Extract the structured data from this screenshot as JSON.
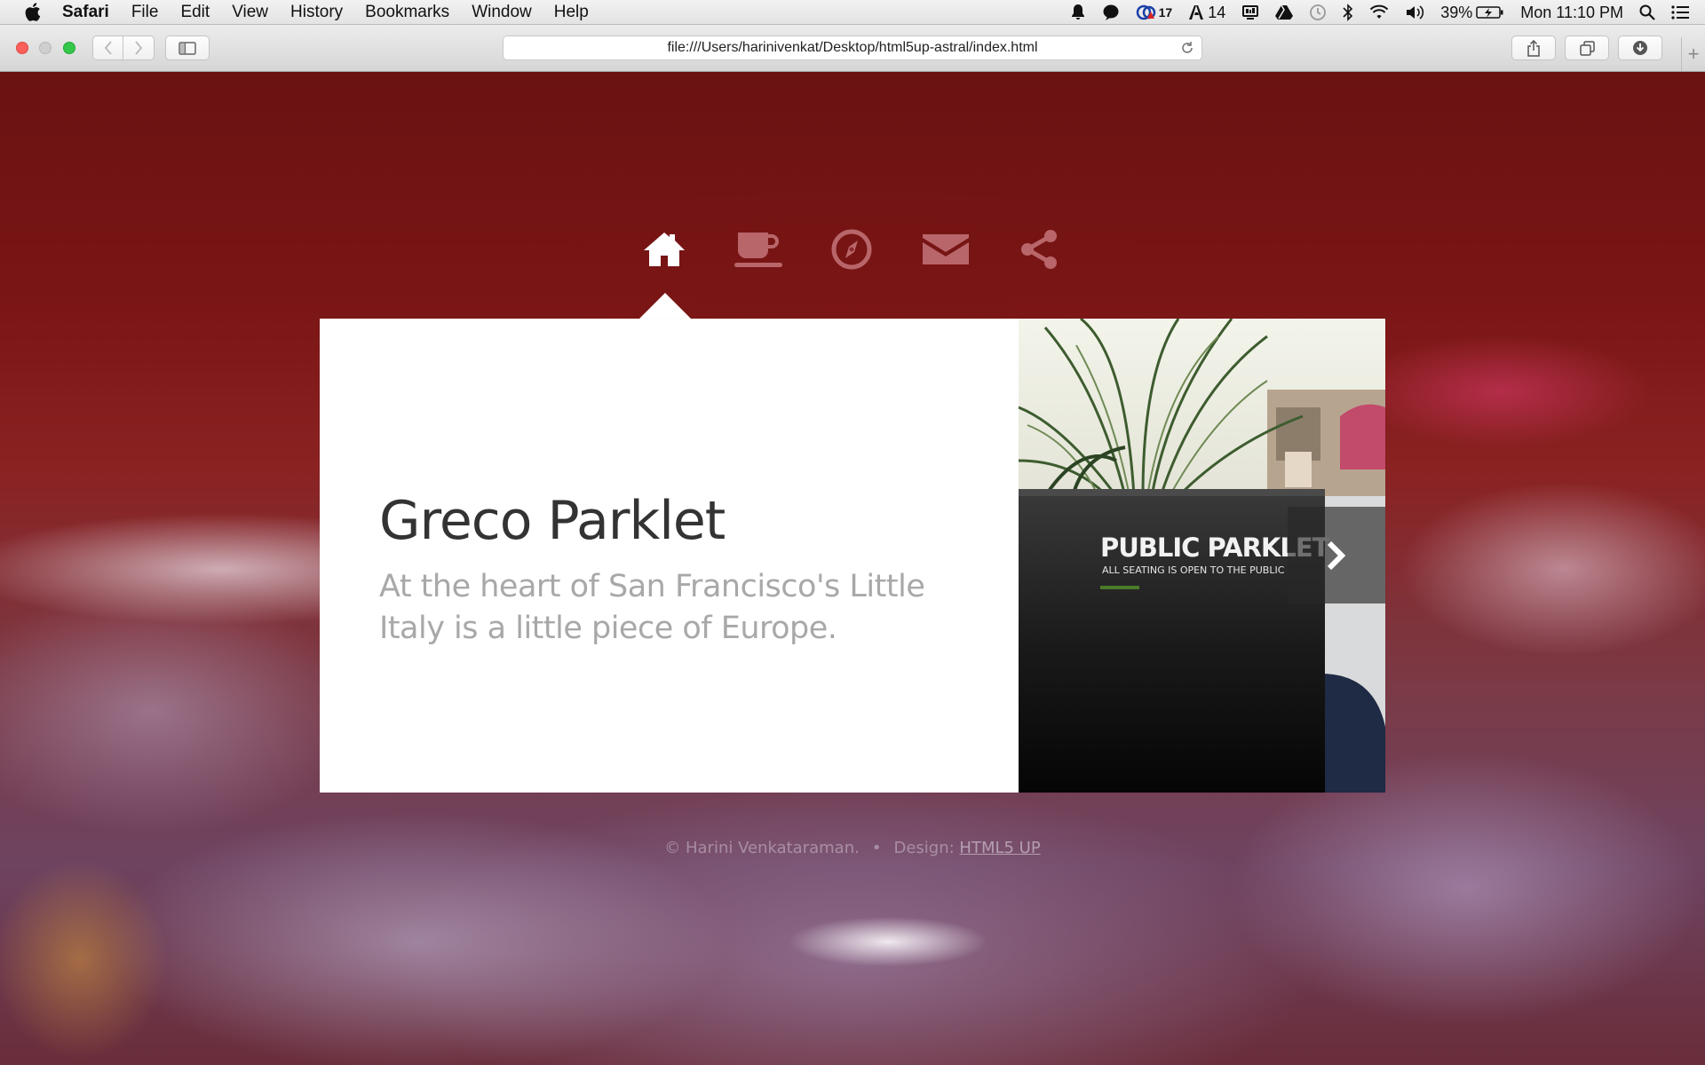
{
  "menubar": {
    "app_name": "Safari",
    "items": [
      "File",
      "Edit",
      "View",
      "History",
      "Bookmarks",
      "Window",
      "Help"
    ],
    "status": {
      "badge_count": "17",
      "adobe_count": "14",
      "battery": "39%",
      "clock": "Mon 11:10 PM"
    }
  },
  "browser": {
    "url": "file:///Users/harinivenkat/Desktop/html5up-astral/index.html"
  },
  "nav": {
    "items": [
      {
        "name": "home",
        "icon": "home-icon",
        "active": true
      },
      {
        "name": "work",
        "icon": "coffee-icon",
        "active": false
      },
      {
        "name": "explore",
        "icon": "compass-icon",
        "active": false
      },
      {
        "name": "contact",
        "icon": "envelope-icon",
        "active": false
      },
      {
        "name": "social",
        "icon": "share-icon",
        "active": false
      }
    ]
  },
  "panel": {
    "title": "Greco Parklet",
    "subtitle": "At the heart of San Francisco's Little Italy is a little piece of Europe.",
    "photo": {
      "sign_title": "PUBLIC PARKLET",
      "sign_subtitle": "ALL SEATING IS OPEN TO THE PUBLIC"
    }
  },
  "footer": {
    "copyright": "© Harini Venkataraman.",
    "design_label": "Design:",
    "design_link": "HTML5 UP"
  },
  "colors": {
    "accent_dark_red": "#6d1414",
    "card_bg": "#ffffff",
    "title_text": "#333333",
    "subtitle_text": "#a8a8a8"
  }
}
